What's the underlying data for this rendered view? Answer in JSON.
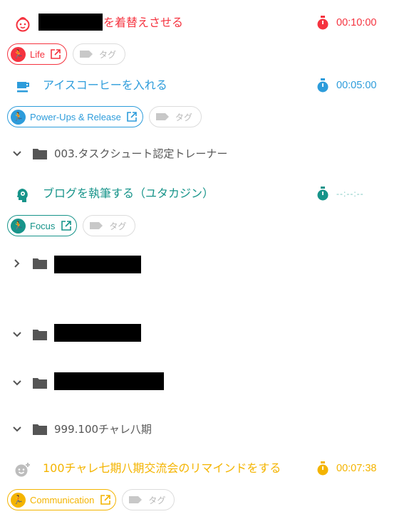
{
  "tasks": [
    {
      "title_suffix": "を着替えさせる",
      "timer": "00:10:00",
      "color": "#f5333f",
      "icon": "baby-face-icon",
      "project": "Life",
      "tag_placeholder": "タグ"
    },
    {
      "title": "アイスコーヒーを入れる",
      "timer": "00:05:00",
      "color": "#2d9cdb",
      "icon": "coffee-cup-icon",
      "project": "Power-Ups & Release",
      "tag_placeholder": "タグ"
    },
    {
      "title": "ブログを執筆する（ユタカジン）",
      "timer": "--:--:--",
      "color": "#17948a",
      "icon": "head-gear-icon",
      "project": "Focus",
      "tag_placeholder": "タグ"
    },
    {
      "title": "100チャレ七期八期交流会のリマインドをする",
      "timer": "00:07:38",
      "color": "#f4b400",
      "icon": "add-emoji-icon",
      "project": "Communication",
      "tag_placeholder": "タグ"
    }
  ],
  "folders": [
    {
      "name": "003.タスクシュート認定トレーナー",
      "expanded": true
    },
    {
      "name": "",
      "expanded": false
    },
    {
      "name": "",
      "expanded": true
    },
    {
      "name": "",
      "expanded": true
    },
    {
      "name": "999.100チャレ八期",
      "expanded": true
    }
  ],
  "colors": {
    "folder": "#555555",
    "tag_gray": "#c8c8c8"
  }
}
